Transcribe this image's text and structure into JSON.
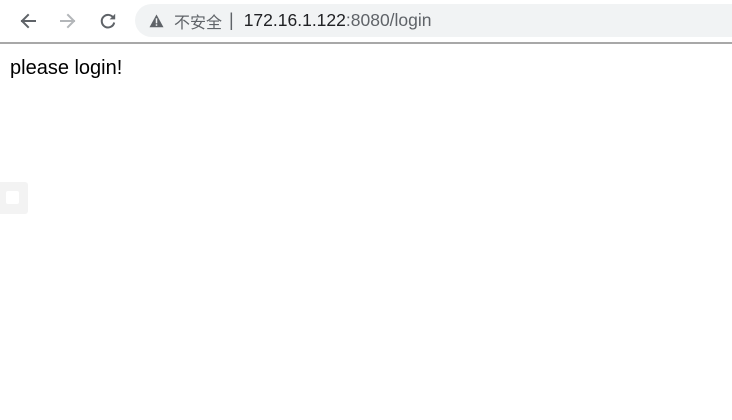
{
  "browser": {
    "icons": {
      "back": "arrow-left-icon",
      "forward": "arrow-right-icon",
      "reload": "reload-icon",
      "security": "warning-triangle-icon"
    },
    "omnibox": {
      "security_label": "不安全",
      "separator": "|",
      "url_host": "172.16.1.122",
      "url_rest": ":8080/login"
    }
  },
  "page": {
    "message": "please login!"
  }
}
